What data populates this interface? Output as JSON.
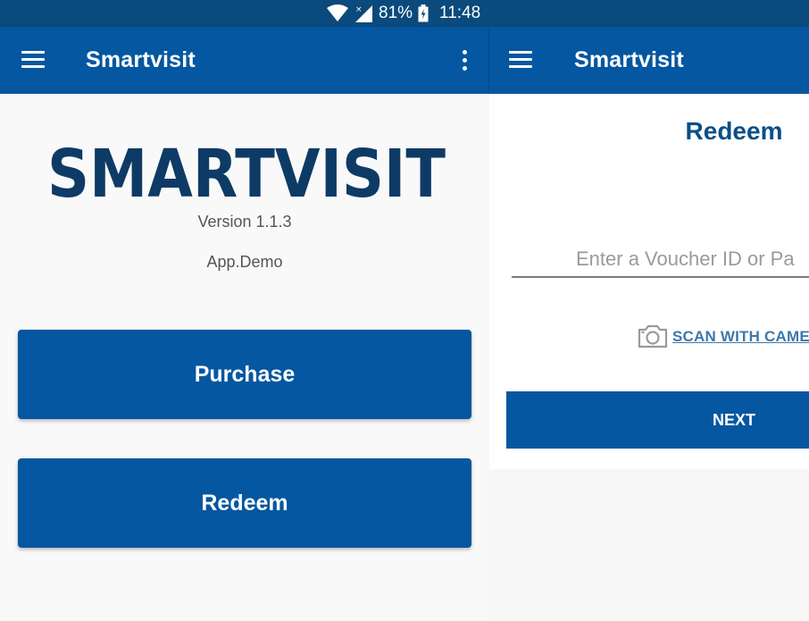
{
  "status_bar": {
    "battery_text": "81%",
    "time": "11:48",
    "icons": [
      "wifi-icon",
      "signal-icon",
      "battery-icon"
    ]
  },
  "left_panel": {
    "app_bar": {
      "title": "Smartvisit",
      "menu_icon": "hamburger-menu-icon",
      "overflow_icon": "more-vert-icon"
    },
    "logo_text": "SMARTVISIT",
    "version": "Version 1.1.3",
    "app_name": "App.Demo",
    "purchase_label": "Purchase",
    "redeem_label": "Redeem"
  },
  "right_panel": {
    "app_bar": {
      "title": "Smartvisit",
      "menu_icon": "hamburger-menu-icon"
    },
    "title": "Redeem",
    "voucher_placeholder": "Enter a Voucher ID or Pa",
    "scan_label": "SCAN WITH CAME",
    "scan_icon": "camera-icon",
    "next_label": "NEXT"
  },
  "colors": {
    "status_bar": "#0a4a7c",
    "primary": "#0457a0",
    "logo_navy": "#0d3b66",
    "title_blue": "#0a4f86",
    "link_blue": "#3d78aa",
    "background": "#f9f9f9"
  }
}
